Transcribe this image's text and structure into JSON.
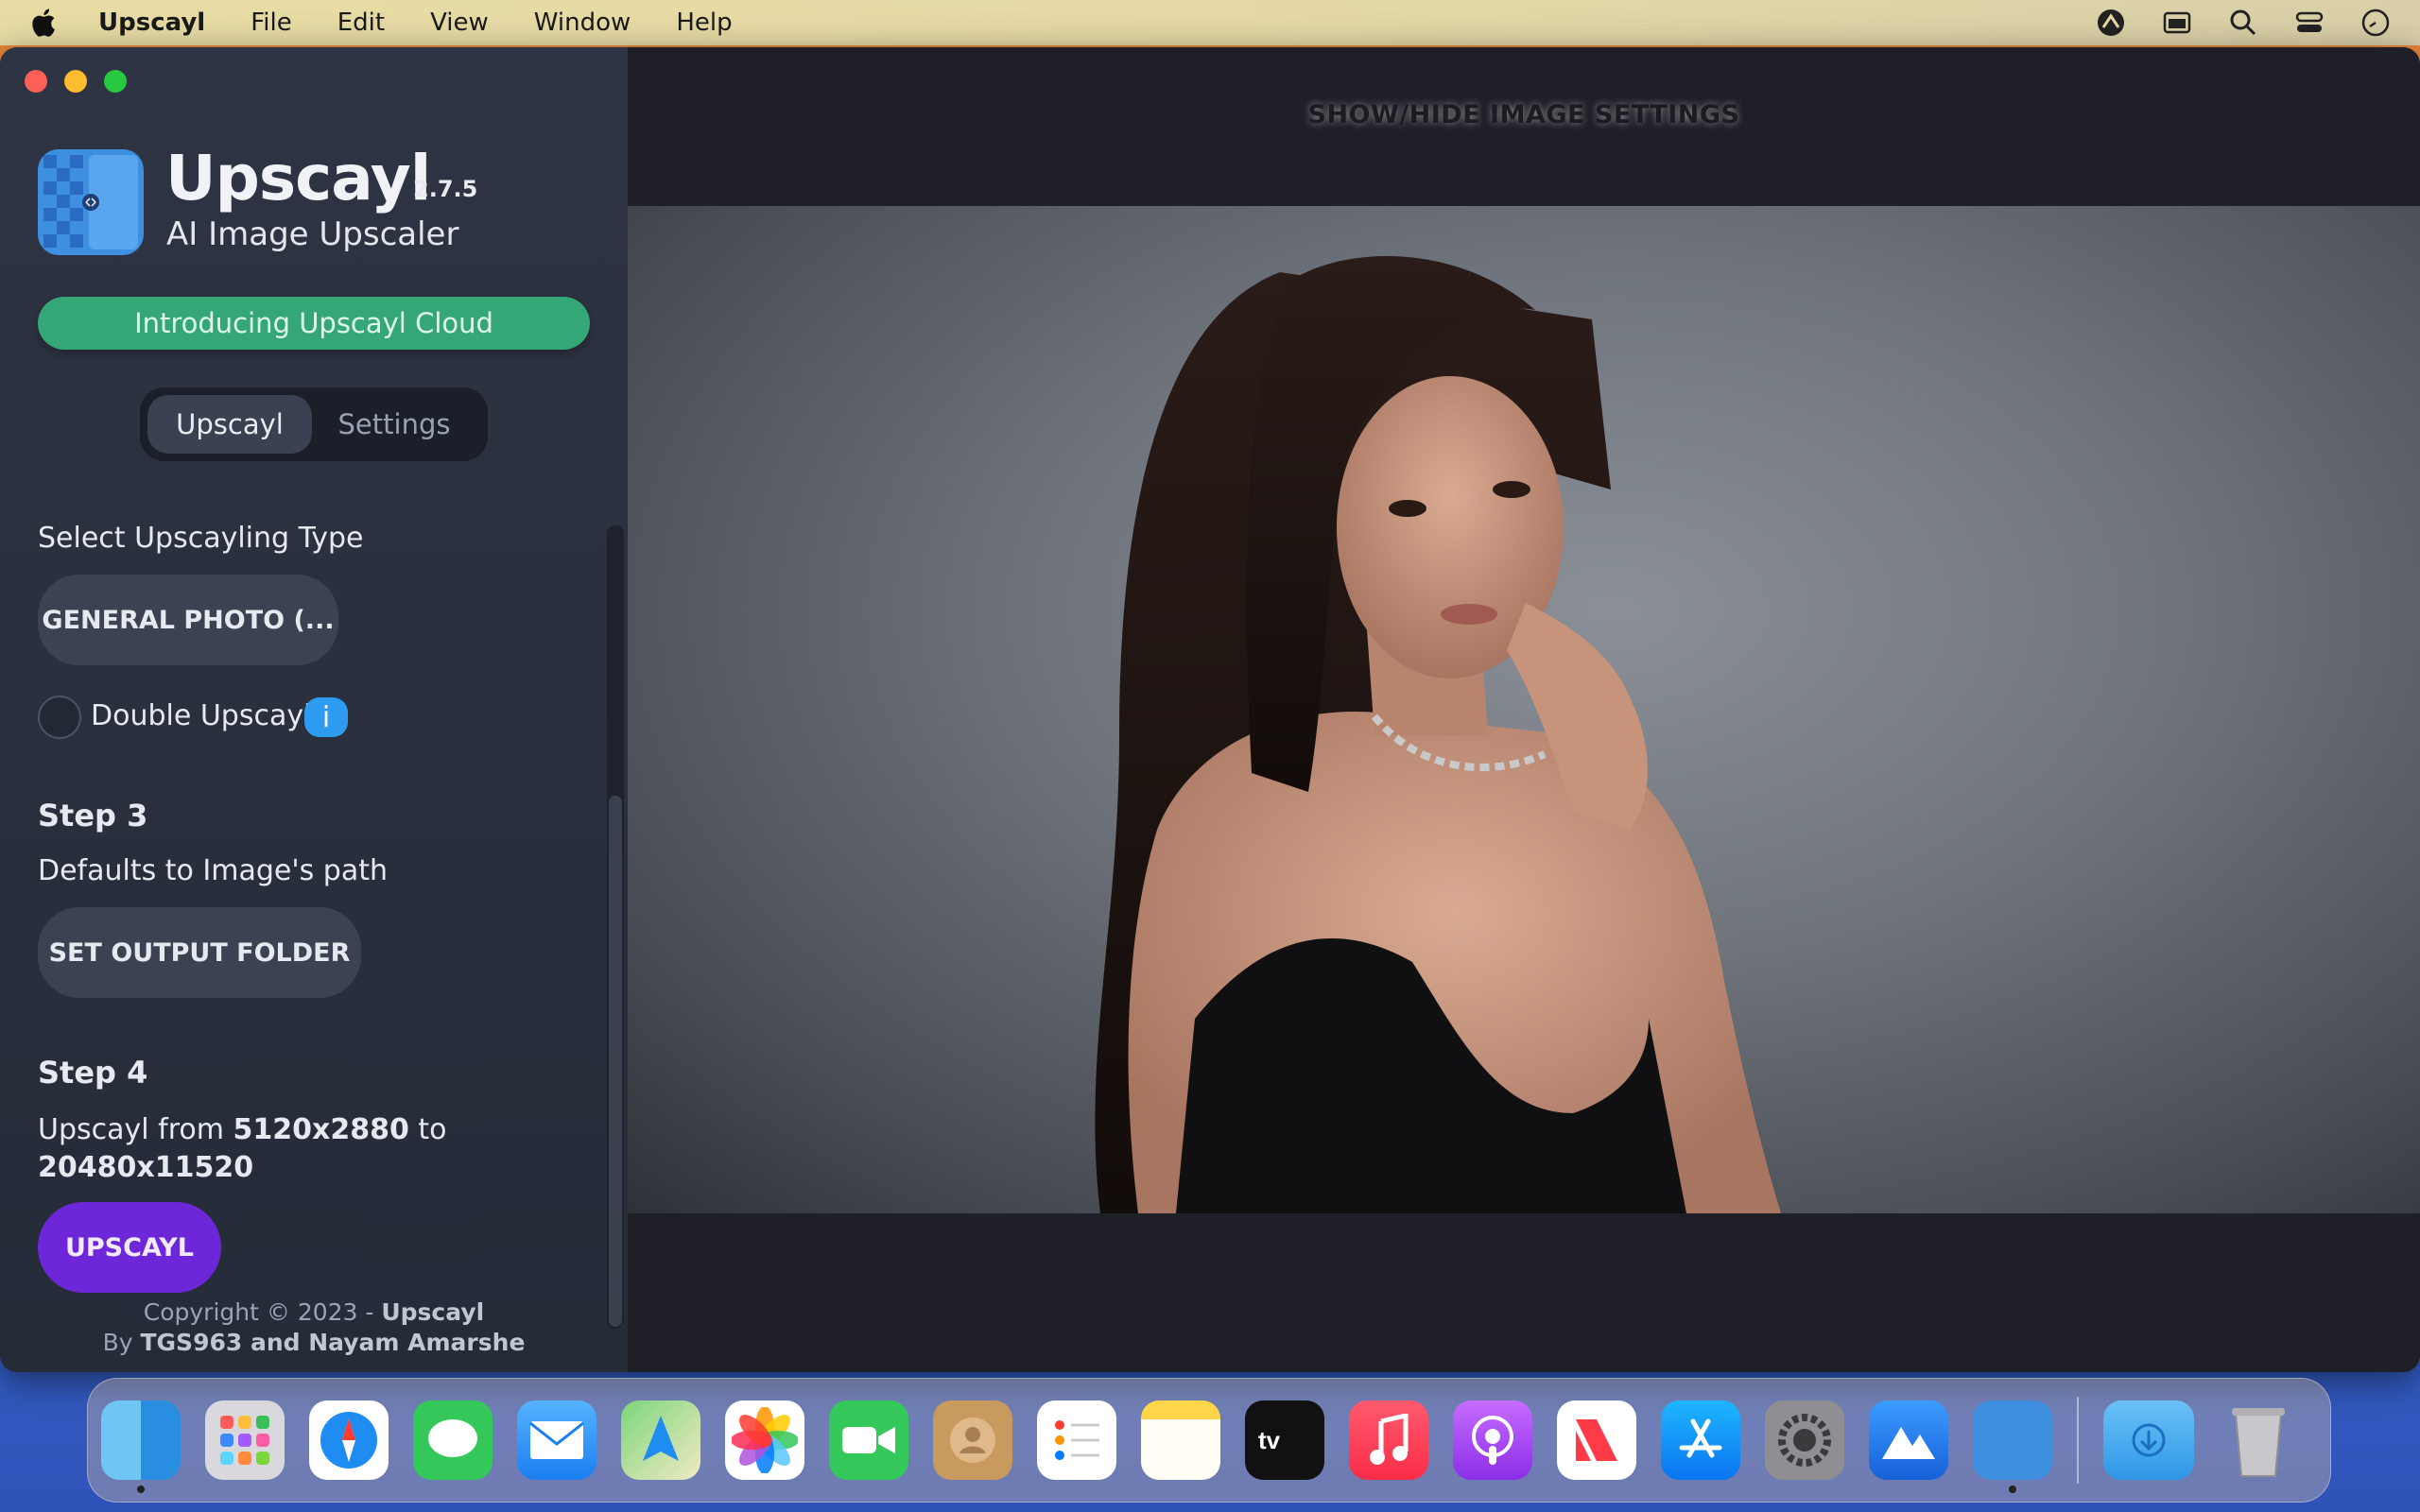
{
  "menubar": {
    "app_name": "Upscayl",
    "items": [
      "File",
      "Edit",
      "View",
      "Window",
      "Help"
    ]
  },
  "sidebar": {
    "app_title": "Upscayl",
    "version": "2.7.5",
    "subtitle": "AI Image Upscaler",
    "cloud_button": "Introducing Upscayl Cloud",
    "tabs": [
      "Upscayl",
      "Settings"
    ],
    "select_type_label": "Select Upscayling Type",
    "model_button": "GENERAL PHOTO (...",
    "double_upscayl_label": "Double Upscayl",
    "info_badge": "i",
    "step3_title": "Step 3",
    "step3_desc": "Defaults to Image's path",
    "output_folder_button": "SET OUTPUT FOLDER",
    "step4_title": "Step 4",
    "upscayl_from_prefix": "Upscayl from",
    "from_resolution": "5120x2880",
    "to_word": "to",
    "to_resolution": "20480x11520",
    "upscayl_button": "UPSCAYL",
    "copyright_prefix": "Copyright © 2023 -",
    "copyright_name": "Upscayl",
    "by_prefix": "By",
    "authors": "TGS963 and Nayam Amarshe"
  },
  "main": {
    "toggle_settings": "SHOW/HIDE IMAGE SETTINGS"
  },
  "colors": {
    "accent_green": "#35a776",
    "accent_purple": "#6d27d9",
    "sidebar_bg": "#2e3443"
  }
}
